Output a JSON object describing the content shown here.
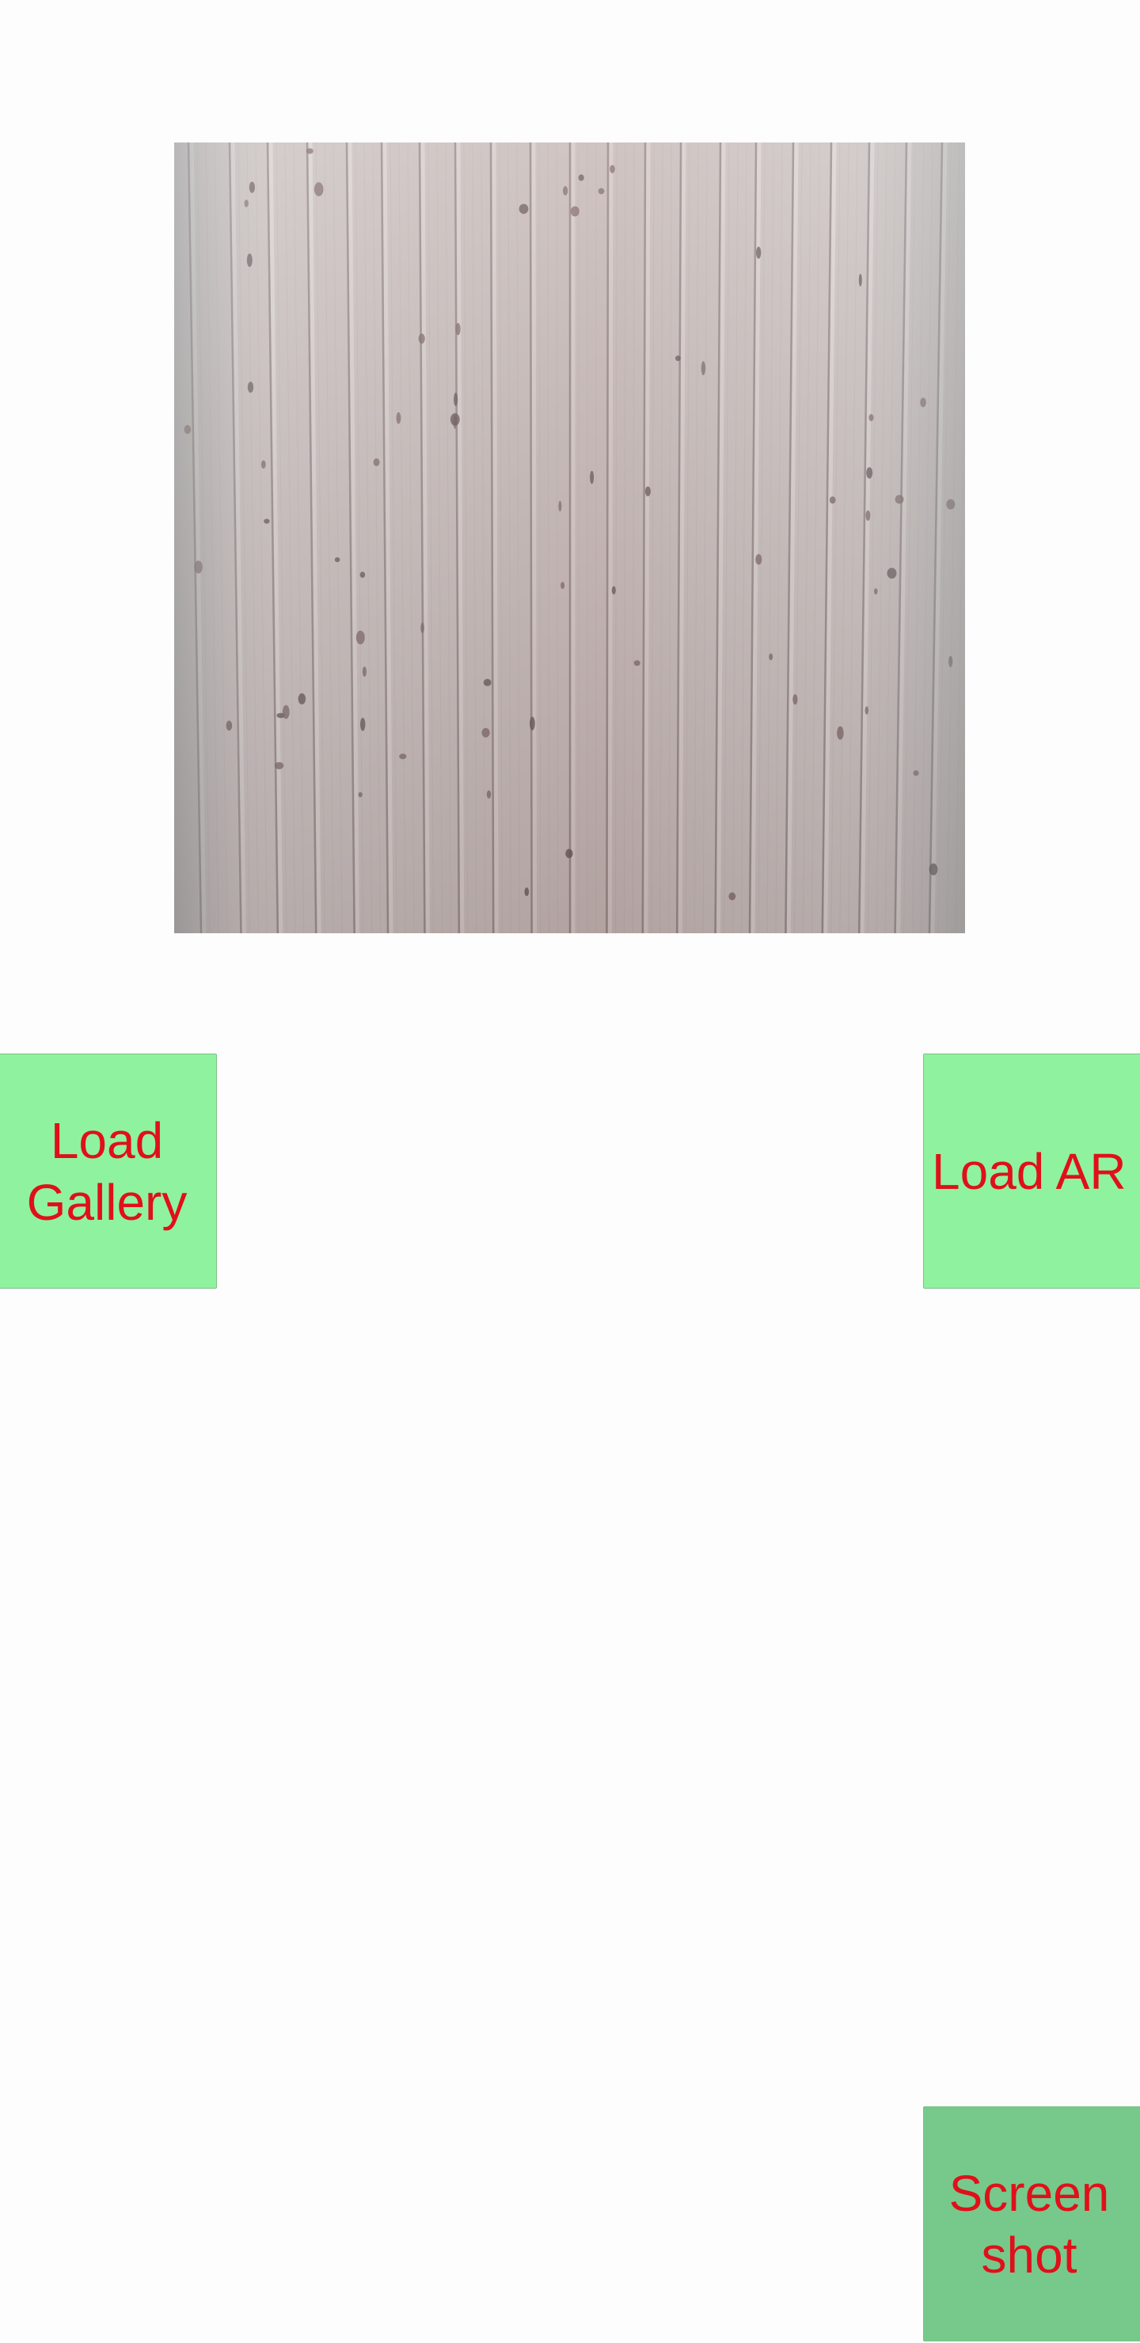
{
  "preview": {
    "image_name": "wood-panel-photo",
    "description_icon": "photo-preview"
  },
  "buttons": {
    "load_gallery": "Load\nGallery",
    "load_ar": "Load AR",
    "screenshot": "Screen\nshot"
  },
  "colors": {
    "background": "#fdfdfd",
    "button_bg": "#8ff29f",
    "button_pressed_bg": "#76c98a",
    "button_text": "#e0101a"
  }
}
